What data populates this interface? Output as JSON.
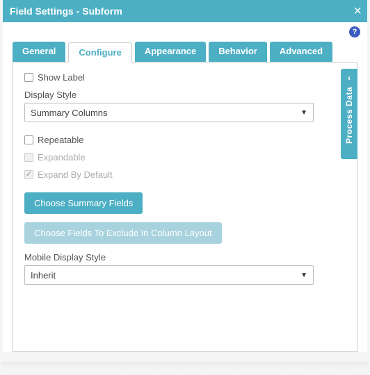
{
  "titlebar": {
    "title": "Field Settings - Subform"
  },
  "tabs": {
    "general": "General",
    "configure": "Configure",
    "appearance": "Appearance",
    "behavior": "Behavior",
    "advanced": "Advanced"
  },
  "side": {
    "label": "Process Data"
  },
  "form": {
    "show_label": "Show Label",
    "display_style_label": "Display Style",
    "display_style_value": "Summary Columns",
    "repeatable": "Repeatable",
    "expandable": "Expandable",
    "expand_default": "Expand By Default",
    "choose_summary": "Choose Summary Fields",
    "choose_exclude": "Choose Fields To Exclude In Column Layout",
    "mobile_label": "Mobile Display Style",
    "mobile_value": "Inherit"
  }
}
